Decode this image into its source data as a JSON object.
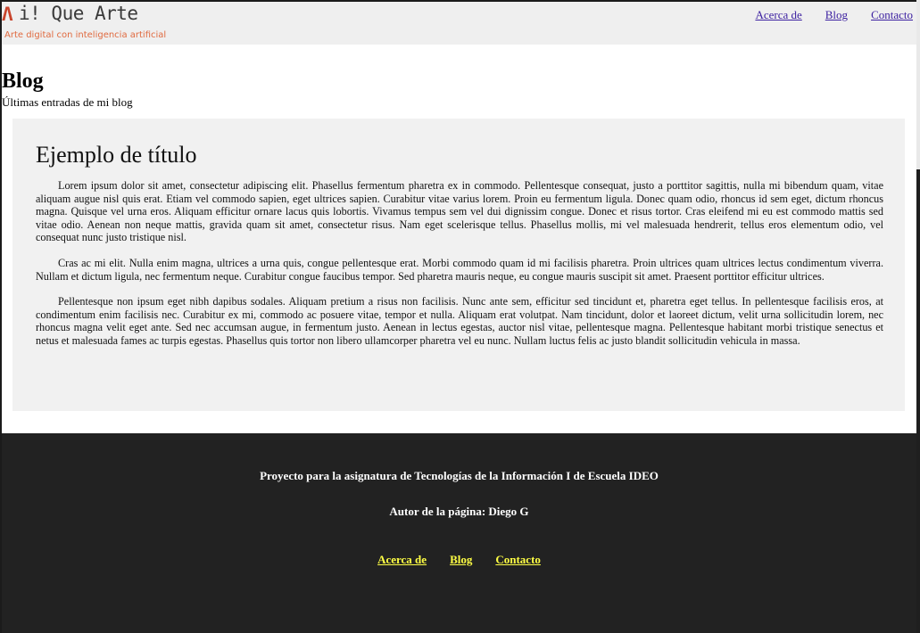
{
  "header": {
    "logo_mark": "Λ",
    "logo_text": "i! Que Arte",
    "tagline": "Arte digital con inteligencia artificial",
    "nav": [
      {
        "label": "Acerca de"
      },
      {
        "label": "Blog"
      },
      {
        "label": "Contacto"
      }
    ]
  },
  "page": {
    "title": "Blog",
    "subtitle": "Últimas entradas de mi blog"
  },
  "post": {
    "title": "Ejemplo de título",
    "paragraphs": [
      "Lorem ipsum dolor sit amet, consectetur adipiscing elit. Phasellus fermentum pharetra ex in commodo. Pellentesque consequat, justo a porttitor sagittis, nulla mi bibendum quam, vitae aliquam augue nisl quis erat. Etiam vel commodo sapien, eget ultrices sapien. Curabitur vitae varius lorem. Proin eu fermentum ligula. Donec quam odio, rhoncus id sem eget, dictum rhoncus magna. Quisque vel urna eros. Aliquam efficitur ornare lacus quis lobortis. Vivamus tempus sem vel dui dignissim congue. Donec et risus tortor. Cras eleifend mi eu est commodo mattis sed vitae odio. Aenean non neque mattis, gravida quam sit amet, consectetur risus. Nam eget scelerisque tellus. Phasellus mollis, mi vel malesuada hendrerit, tellus eros elementum odio, vel consequat nunc justo tristique nisl.",
      "Cras ac mi elit. Nulla enim magna, ultrices a urna quis, congue pellentesque erat. Morbi commodo quam id mi facilisis pharetra. Proin ultrices quam ultrices lectus condimentum viverra. Nullam et dictum ligula, nec fermentum neque. Curabitur congue faucibus tempor. Sed pharetra mauris neque, eu congue mauris suscipit sit amet. Praesent porttitor efficitur ultrices.",
      "Pellentesque non ipsum eget nibh dapibus sodales. Aliquam pretium a risus non facilisis. Nunc ante sem, efficitur sed tincidunt et, pharetra eget tellus. In pellentesque facilisis eros, at condimentum enim facilisis nec. Curabitur ex mi, commodo ac posuere vitae, tempor et nulla. Aliquam erat volutpat. Nam tincidunt, dolor et laoreet dictum, velit urna sollicitudin lorem, nec rhoncus magna velit eget ante. Sed nec accumsan augue, in fermentum justo. Aenean in lectus egestas, auctor nisl vitae, pellentesque magna. Pellentesque habitant morbi tristique senectus et netus et malesuada fames ac turpis egestas. Phasellus quis tortor non libero ullamcorper pharetra vel eu nunc. Nullam luctus felis ac justo blandit sollicitudin vehicula in massa."
    ]
  },
  "footer": {
    "project": "Proyecto para la asignatura de Tecnologías de la Información I de Escuela IDEO",
    "author": "Autor de la página: Diego G",
    "nav": [
      {
        "label": "Acerca de"
      },
      {
        "label": "Blog"
      },
      {
        "label": "Contacto"
      }
    ]
  },
  "colors": {
    "header_bg": "#efefef",
    "card_bg": "#f1f1f1",
    "footer_bg": "#222222",
    "header_link": "#3b1fa0",
    "footer_link": "#ffff44",
    "logo_accent": "#c8442c",
    "tagline": "#e06a3f"
  }
}
